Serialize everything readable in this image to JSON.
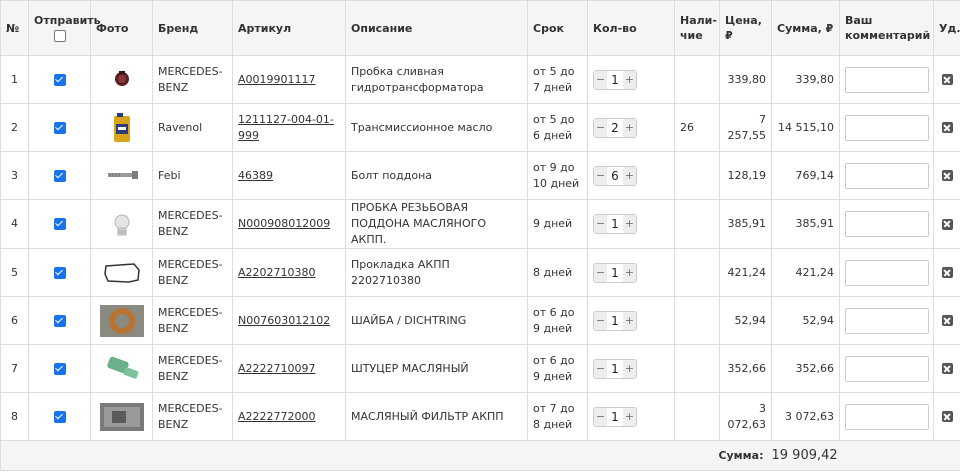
{
  "columns": {
    "num": "№",
    "send": "Отправить",
    "photo": "Фото",
    "brand": "Бренд",
    "article": "Артикул",
    "description": "Описание",
    "term": "Срок",
    "qty": "Кол-во",
    "stock": "Нали-\nчие",
    "price": "Цена, ₽",
    "sum": "Сумма, ₽",
    "comment": "Ваш комментарий",
    "delete": "Уд."
  },
  "rows": [
    {
      "num": "1",
      "brand": "MERCEDES-BENZ",
      "article": "A0019901117",
      "description": "Пробка сливная гидротрансформатора",
      "term": "от 5 до 7 дней",
      "qty": "1",
      "stock": "",
      "price": "339,80",
      "sum": "339,80",
      "photo_icon": "drain-plug-photo",
      "checked": true
    },
    {
      "num": "2",
      "brand": "Ravenol",
      "article": "1211127-004-01-999",
      "description": "Трансмиссионное масло",
      "term": "от 5 до 6 дней",
      "qty": "2",
      "stock": "26",
      "price": "7 257,55",
      "sum": "14 515,10",
      "photo_icon": "oil-canister-photo",
      "checked": true
    },
    {
      "num": "3",
      "brand": "Febi",
      "article": "46389",
      "description": "Болт поддона",
      "term": "от 9 до 10 дней",
      "qty": "6",
      "stock": "",
      "price": "128,19",
      "sum": "769,14",
      "photo_icon": "bolt-photo",
      "checked": true
    },
    {
      "num": "4",
      "brand": "MERCEDES-BENZ",
      "article": "N000908012009",
      "description": "ПРОБКА РЕЗЬБОВАЯ ПОДДОНА МАСЛЯНОГО АКПП.",
      "term": "9 дней",
      "qty": "1",
      "stock": "",
      "price": "385,91",
      "sum": "385,91",
      "photo_icon": "threaded-plug-photo",
      "checked": true
    },
    {
      "num": "5",
      "brand": "MERCEDES-BENZ",
      "article": "A2202710380",
      "description": "Прокладка АКПП 2202710380",
      "term": "8 дней",
      "qty": "1",
      "stock": "",
      "price": "421,24",
      "sum": "421,24",
      "photo_icon": "gasket-photo",
      "checked": true
    },
    {
      "num": "6",
      "brand": "MERCEDES-BENZ",
      "article": "N007603012102",
      "description": "ШАЙБА / DICHTRING",
      "term": "от 6 до 9 дней",
      "qty": "1",
      "stock": "",
      "price": "52,94",
      "sum": "52,94",
      "photo_icon": "washer-photo",
      "checked": true
    },
    {
      "num": "7",
      "brand": "MERCEDES-BENZ",
      "article": "A2222710097",
      "description": "ШТУЦЕР МАСЛЯНЫЙ",
      "term": "от 6 до 9 дней",
      "qty": "1",
      "stock": "",
      "price": "352,66",
      "sum": "352,66",
      "photo_icon": "oil-fitting-photo",
      "checked": true
    },
    {
      "num": "8",
      "brand": "MERCEDES-BENZ",
      "article": "A2222772000",
      "description": "МАСЛЯНЫЙ ФИЛЬТР АКПП",
      "term": "от 7 до 8 дней",
      "qty": "1",
      "stock": "",
      "price": "3 072,63",
      "sum": "3 072,63",
      "photo_icon": "oil-filter-photo",
      "checked": true
    }
  ],
  "stepper": {
    "minus": "−",
    "plus": "+"
  },
  "footer": {
    "total_label": "Сумма:",
    "total_value": "19 909,42"
  },
  "colors": {
    "checkbox": "#1a73e8",
    "header_bg": "#f5f5f5",
    "border": "#dddddd"
  }
}
